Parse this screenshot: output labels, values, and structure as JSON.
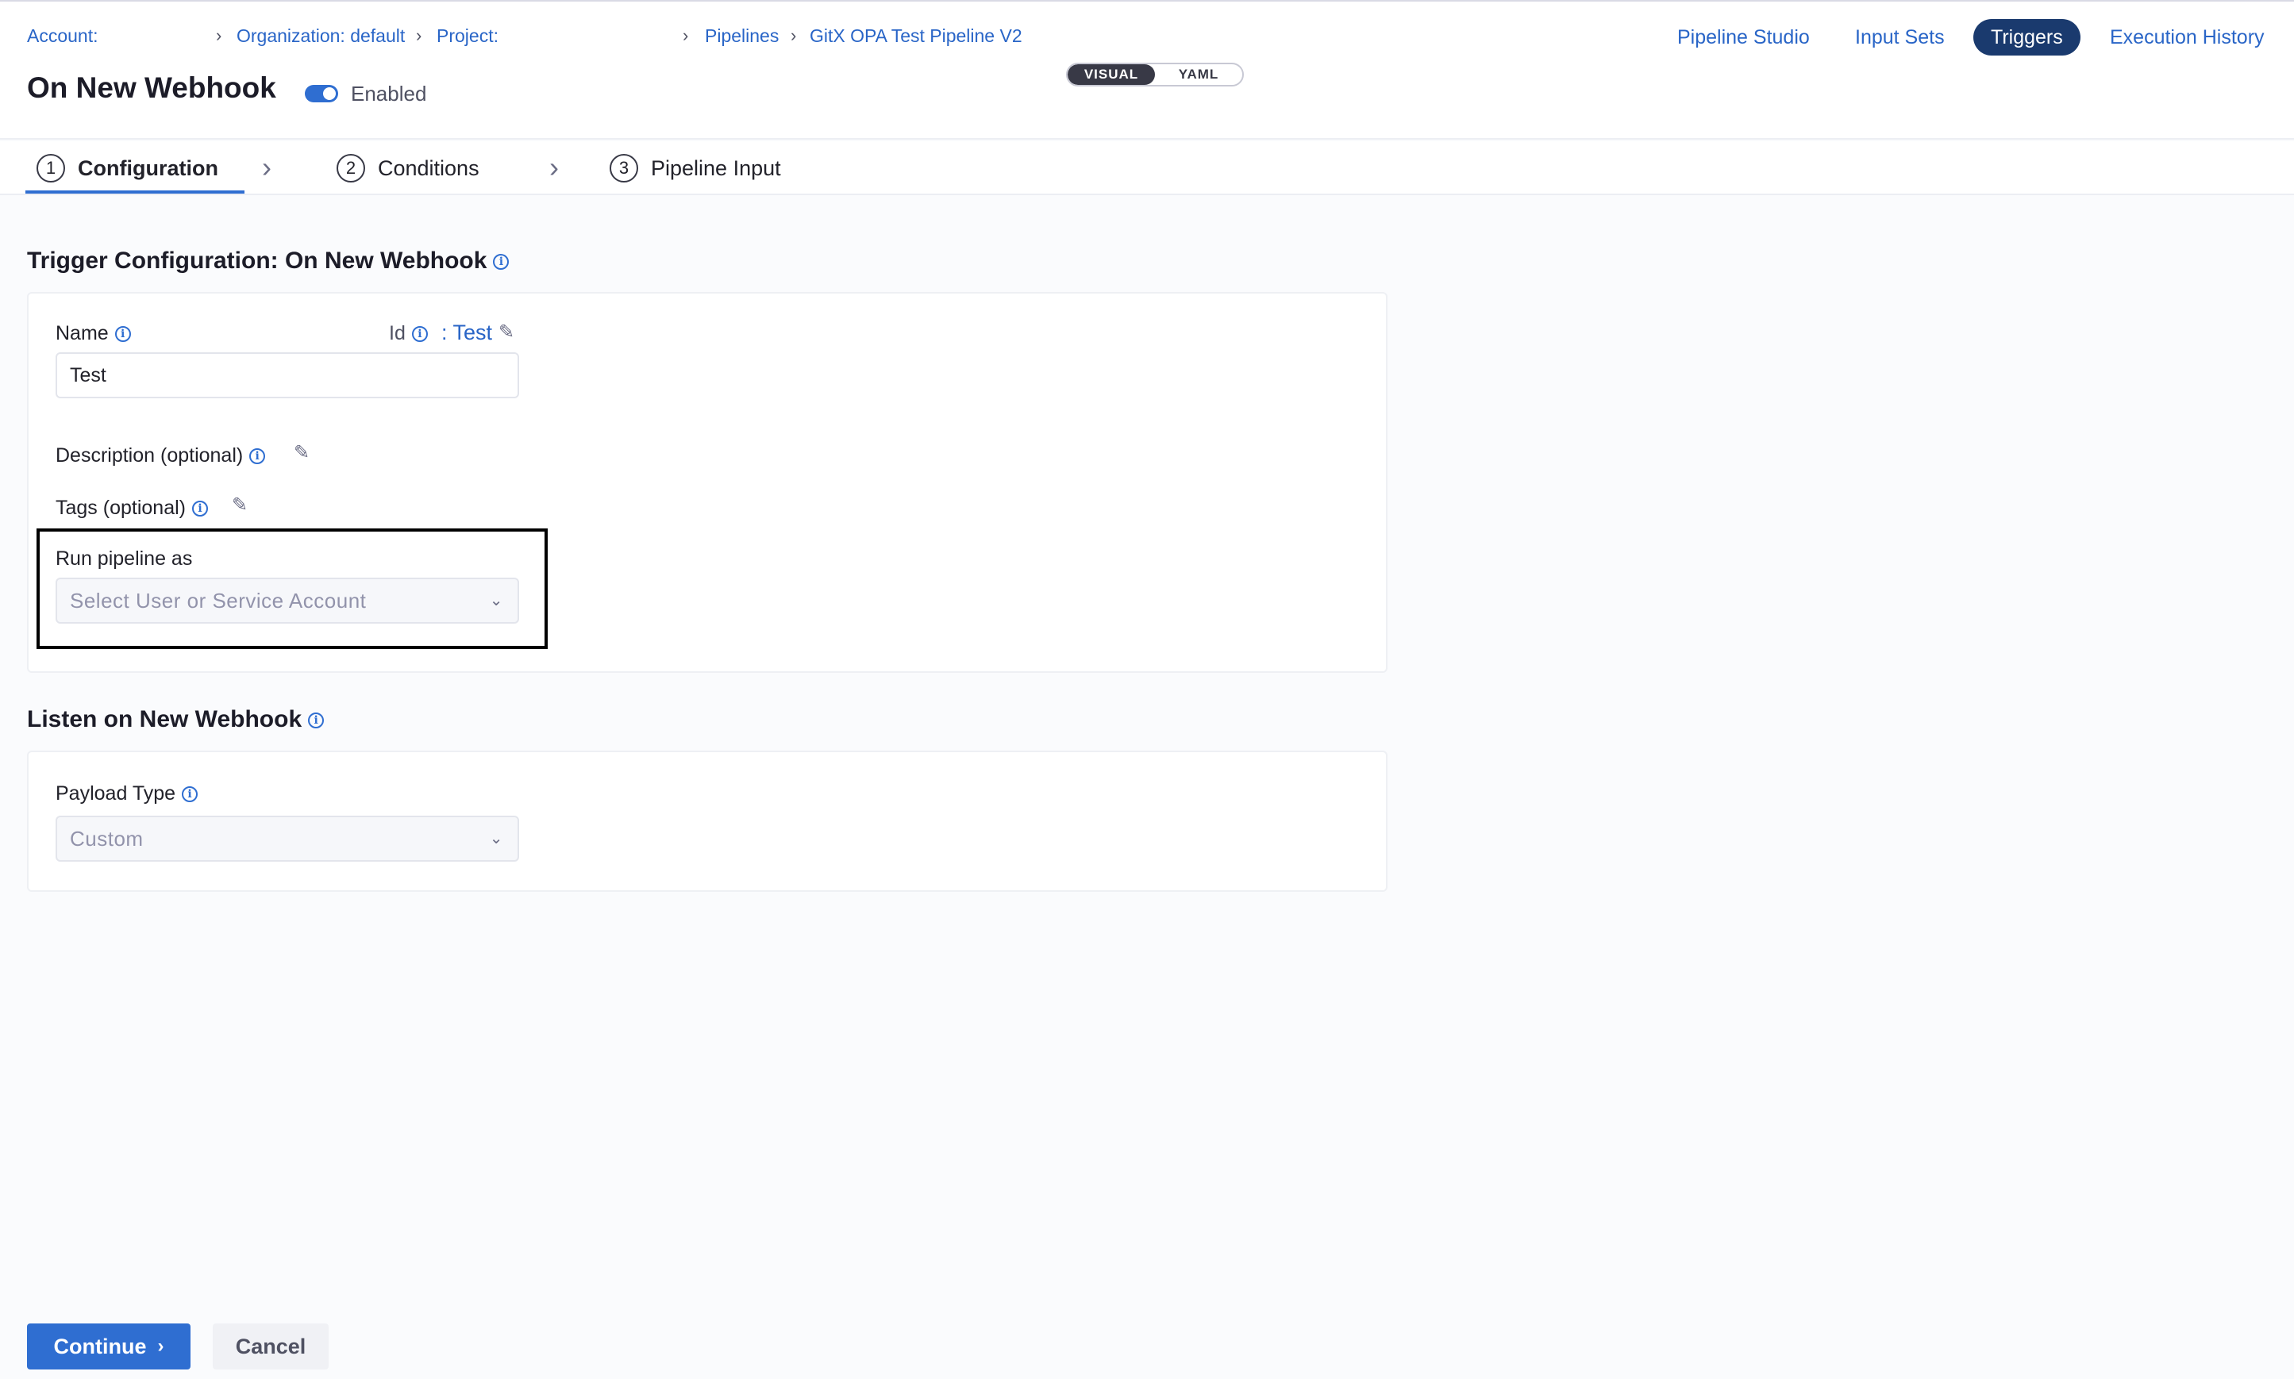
{
  "breadcrumb": {
    "account": "Account: ",
    "organization": "Organization: default",
    "project": "Project: ",
    "pipelines": "Pipelines",
    "pipeline_name": "GitX OPA Test Pipeline V2"
  },
  "header": {
    "title": "On New Webhook",
    "enabled_label": "Enabled",
    "view_visual": "VISUAL",
    "view_yaml": "YAML"
  },
  "topnav": {
    "pipeline_studio": "Pipeline Studio",
    "input_sets": "Input Sets",
    "triggers": "Triggers",
    "execution_history": "Execution History"
  },
  "tabs": [
    {
      "num": "1",
      "label": "Configuration"
    },
    {
      "num": "2",
      "label": "Conditions"
    },
    {
      "num": "3",
      "label": "Pipeline Input"
    }
  ],
  "config": {
    "section_title": "Trigger Configuration: On New Webhook",
    "name_label": "Name",
    "id_label": "Id",
    "id_value": ": Test",
    "name_value": "Test",
    "description_label": "Description (optional)",
    "tags_label": "Tags (optional)",
    "run_as_label": "Run pipeline as",
    "run_as_placeholder": "Select User or Service Account"
  },
  "webhook": {
    "section_title": "Listen on New Webhook",
    "payload_label": "Payload Type",
    "payload_value": "Custom"
  },
  "footer": {
    "continue": "Continue",
    "cancel": "Cancel"
  },
  "colors": {
    "accent": "#2f6ed1",
    "link": "#2965c7",
    "active_nav": "#1a3a6e"
  }
}
